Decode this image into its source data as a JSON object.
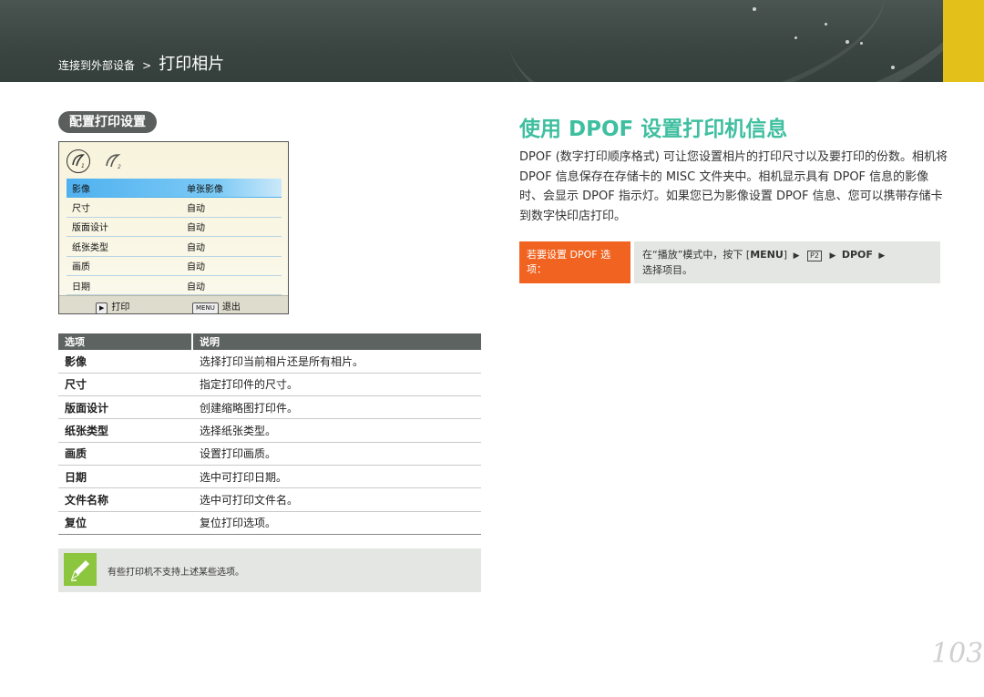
{
  "header": {
    "breadcrumb_parent": "连接到外部设备",
    "breadcrumb_sep": ">",
    "breadcrumb_current": "打印相片"
  },
  "left": {
    "section_title": "配置打印设置",
    "camera": {
      "icon_1": "P1",
      "icon_2": "P2",
      "rows": [
        {
          "key": "影像",
          "value": "单张影像"
        },
        {
          "key": "尺寸",
          "value": "自动"
        },
        {
          "key": "版面设计",
          "value": "自动"
        },
        {
          "key": "纸张类型",
          "value": "自动"
        },
        {
          "key": "画质",
          "value": "自动"
        },
        {
          "key": "日期",
          "value": "自动"
        }
      ],
      "footer_print": "打印",
      "footer_menu_key": "MENU",
      "footer_exit": "退出"
    },
    "table": {
      "headers": [
        "选项",
        "说明"
      ],
      "rows": [
        {
          "option": "影像",
          "desc": "选择打印当前相片还是所有相片。"
        },
        {
          "option": "尺寸",
          "desc": "指定打印件的尺寸。"
        },
        {
          "option": "版面设计",
          "desc": "创建缩略图打印件。"
        },
        {
          "option": "纸张类型",
          "desc": "选择纸张类型。"
        },
        {
          "option": "画质",
          "desc": "设置打印画质。"
        },
        {
          "option": "日期",
          "desc": "选中可打印日期。"
        },
        {
          "option": "文件名称",
          "desc": "选中可打印文件名。"
        },
        {
          "option": "复位",
          "desc": "复位打印选项。"
        }
      ]
    },
    "note": "有些打印机不支持上述某些选项。"
  },
  "right": {
    "title": "使用 DPOF 设置打印机信息",
    "body": "DPOF (数字打印顺序格式) 可让您设置相片的打印尺寸以及要打印的份数。相机将 DPOF 信息保存在存储卡的 MISC 文件夹中。相机显示具有 DPOF 信息的影像时、会显示 DPOF 指示灯。如果您已为影像设置 DPOF 信息、您可以携带存储卡到数字快印店打印。",
    "tip_label": "若要设置 DPOF 选项：",
    "tip_text_1": "在“播放”模式中，按下 [",
    "tip_menu": "MENU",
    "tip_text_2": "]",
    "tip_icon": "P2",
    "tip_dpof": "DPOF",
    "tip_text_3": "选择项目。"
  },
  "page_number": "103"
}
